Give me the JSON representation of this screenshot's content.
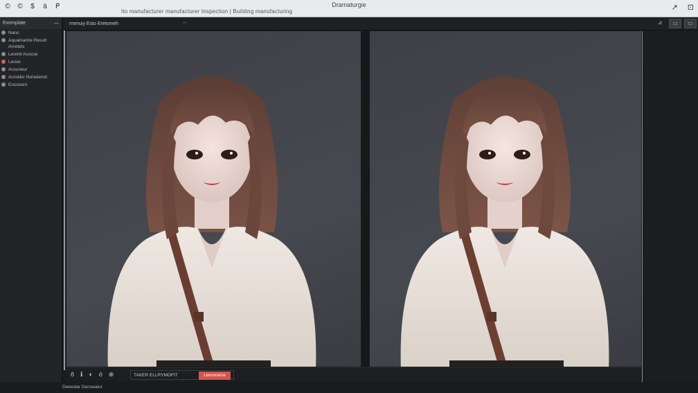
{
  "titlebar": {
    "left_icons": [
      "©",
      "©",
      "$",
      "ä",
      "ᑭ"
    ],
    "title": "Dramaturgie",
    "subtitle": "Ito manufacturer manufacturer Inspection | Building manufacturing",
    "right_icons": [
      "↗",
      "⊡"
    ]
  },
  "leftpanel": {
    "header": "Exemplate",
    "items": [
      {
        "label": "Nano",
        "red": false
      },
      {
        "label": "Aquamarine Result Amolets",
        "red": false
      },
      {
        "label": "Leomit Asocue",
        "red": false
      },
      {
        "label": "Leose",
        "red": true
      },
      {
        "label": "Acsuneur",
        "red": false
      },
      {
        "label": "Acrokler Ifumelenot",
        "red": false
      },
      {
        "label": "Enconeni",
        "red": false
      }
    ]
  },
  "tabs": {
    "active": "rmmuiy Esto Eretomeh",
    "close": "ᐩᐩ"
  },
  "view_buttons": [
    "⊿",
    "▭",
    "▭"
  ],
  "bottombar": {
    "icons": [
      "ô",
      "ℹ",
      "◐",
      "ó",
      "⊕"
    ],
    "label": "TAKER ELLRYMOFIT",
    "accent": "Lenosrance"
  },
  "status": {
    "text": "Deewdar Denseatur"
  },
  "colors": {
    "accent": "#d6534c",
    "canvas": "#44464c",
    "panel": "#232427"
  }
}
